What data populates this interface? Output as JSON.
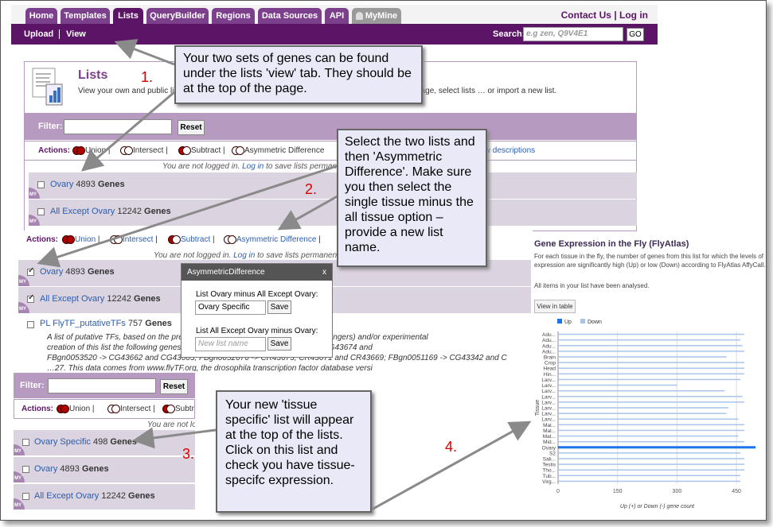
{
  "nav": {
    "tabs": [
      "Home",
      "Templates",
      "Lists",
      "QueryBuilder",
      "Regions",
      "Data Sources",
      "API",
      "MyMine"
    ],
    "contact": "Contact Us | Log in",
    "sub_upload": "Upload",
    "sub_view": "View",
    "search_label": "Search:",
    "search_placeholder": "e.g zen, Q9V4E1",
    "go": "GO"
  },
  "lists_page": {
    "title": "Lists",
    "desc": "View your own and public lists here. Click on a list to view graphs and summaries in an analysis page, select lists … or import a new list.",
    "filter_label": "Filter:",
    "reset": "Reset",
    "actions_label": "Actions:",
    "action_union": "Union",
    "action_intersect": "Intersect",
    "action_subtract": "Subtract",
    "action_asym": "Asymmetric Difference",
    "show_descriptions": "Show descriptions",
    "not_logged_1": "You are not logged in.",
    "log_in": "Log in",
    "not_logged_2": "to save lists permanently",
    "my": "MY"
  },
  "lists": {
    "ovary": {
      "name": "Ovary",
      "count": "4893",
      "unit": "Genes"
    },
    "all_except": {
      "name": "All Except Ovary",
      "count": "12242",
      "unit": "Genes"
    },
    "tf": {
      "name": "PL FlyTF_putativeTFs",
      "count": "757",
      "unit": "Genes"
    },
    "specific": {
      "name": "Ovary Specific",
      "count": "498",
      "unit": "Genes"
    }
  },
  "tf_desc": {
    "l1": "A list of putative TFs, based on the presence of … domain (including C2H2 zinc fingers) and/or experimental",
    "l2": "creation of this list the following genes … further verification: FBgn0053936 -> CG43674 and",
    "l3": "FBgn0053520 -> CG43662 and CG43663, FBgn0052076 -> CR43673, CR43671 and CR43669; FBgn0051169 -> CG43342 and C",
    "l4": "…27. This data comes from www.flyTF.org, the drosophila transcription factor database versi"
  },
  "dialog": {
    "title": "AsymmetricDifference",
    "close": "x",
    "label1": "List Ovary minus All Except Ovary:",
    "value1": "Ovary Specific",
    "save": "Save",
    "label2": "List All Except Ovary minus Ovary:",
    "placeholder2": "New list name"
  },
  "callouts": {
    "c1": "Your two sets of genes can be found under the lists 'view' tab. They should be at the top of the page.",
    "c2": "Select the two lists and then 'Asymmetric Difference'.  Make sure you then select the single tissue minus the all tissue option – provide a new list name.",
    "c3": "Your new 'tissue specific' list will appear at the top of the lists.  Click on this list and check you have tissue-specifc expression.",
    "n1": "1.",
    "n2": "2.",
    "n3": "3.",
    "n4": "4."
  },
  "chart_data": {
    "type": "bar",
    "title": "Gene Expression in the Fly (FlyAtlas)",
    "description": "For each tissue in the fly, the number of genes from this list for which the levels of expression are significantly high (Up) or low (Down) according to FlyAtlas AffyCall.",
    "analysed": "All items in your list have been analysed.",
    "view_button": "View in table",
    "legend": [
      "Up",
      "Down"
    ],
    "ylabel": "Tissue",
    "xlabel": "Up (+) or Down (-) gene count",
    "xticks": [
      "0",
      "150",
      "300",
      "450"
    ],
    "xlim": [
      0,
      500
    ],
    "categories": [
      "Adu...",
      "Adu...",
      "Adu...",
      "Adu...",
      "Brain",
      "Crop",
      "Head",
      "Hin...",
      "Larv...",
      "Larv...",
      "Larv...",
      "Larv...",
      "Larv...",
      "Larv...",
      "Larv...",
      "Larv...",
      "Mal...",
      "Mal...",
      "Mat...",
      "Mid...",
      "Ovary",
      "S2",
      "Sali...",
      "Testis",
      "Tho...",
      "Tub...",
      "Virg..."
    ],
    "series": [
      {
        "name": "Up",
        "values": [
          0,
          0,
          0,
          0,
          0,
          0,
          0,
          0,
          0,
          0,
          0,
          0,
          0,
          0,
          0,
          0,
          0,
          0,
          0,
          0,
          498,
          0,
          0,
          0,
          0,
          0,
          0
        ]
      },
      {
        "name": "Down",
        "values": [
          470,
          460,
          465,
          470,
          425,
          470,
          470,
          470,
          460,
          300,
          420,
          465,
          470,
          430,
          425,
          455,
          470,
          470,
          455,
          470,
          0,
          460,
          470,
          470,
          470,
          460,
          460
        ]
      }
    ],
    "colors": {
      "up": "#1a73e8",
      "down": "#a9c4ec"
    }
  }
}
